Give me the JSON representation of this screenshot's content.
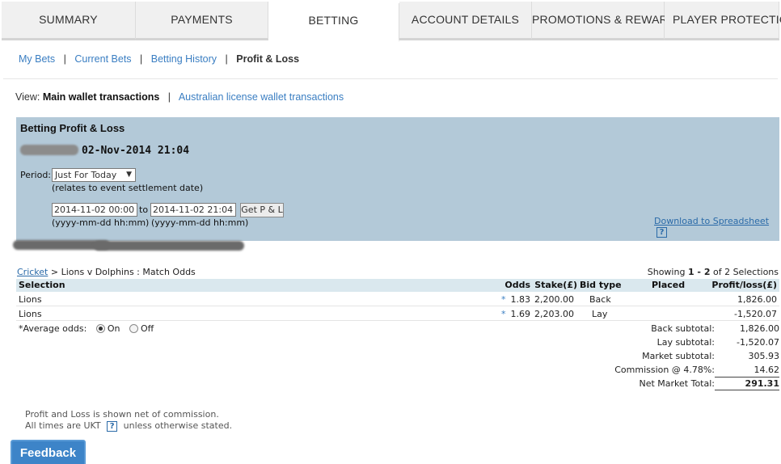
{
  "tabs": [
    {
      "label": "SUMMARY"
    },
    {
      "label": "PAYMENTS"
    },
    {
      "label": "BETTING"
    },
    {
      "label": "ACCOUNT DETAILS"
    },
    {
      "label": "PROMOTIONS & REWARDS"
    },
    {
      "label": "PLAYER PROTECTION"
    }
  ],
  "subnav": {
    "my_bets": "My Bets",
    "current_bets": "Current Bets",
    "betting_history": "Betting History",
    "profit_loss": "Profit & Loss",
    "separator": "|"
  },
  "view": {
    "prefix": "View:",
    "main": "Main wallet transactions",
    "separator": "|",
    "australian": "Australian license wallet transactions"
  },
  "panel": {
    "title": "Betting Profit & Loss",
    "datetime": "02-Nov-2014 21:04",
    "period_label": "Period:",
    "period_value": "Just For Today",
    "period_arrow": "▼",
    "relates_note": "(relates to event settlement date)",
    "from_value": "2014-11-02 00:00",
    "to_label": "to",
    "to_value": "2014-11-02 21:04",
    "format_hint": "(yyyy-mm-dd hh:mm)",
    "get_button": "Get P & L",
    "download_link": "Download to Spreadsheet",
    "help": "?"
  },
  "results": {
    "crumb_sport": "Cricket",
    "crumb_rest": " > Lions v Dolphins : Match Odds",
    "showing_prefix": "Showing ",
    "showing_range": "1 - 2",
    "showing_suffix": " of 2 Selections",
    "headers": {
      "selection": "Selection",
      "odds": "Odds",
      "stake": "Stake(£)",
      "bid_type": "Bid type",
      "placed": "Placed",
      "profit": "Profit/loss(£)"
    },
    "rows": [
      {
        "selection": "Lions",
        "star": "*",
        "odds": "1.83",
        "stake": "2,200.00",
        "bid_type": "Back",
        "placed": "",
        "profit": "1,826.00"
      },
      {
        "selection": "Lions",
        "star": "*",
        "odds": "1.69",
        "stake": "2,203.00",
        "bid_type": "Lay",
        "placed": "",
        "profit": "-1,520.07"
      }
    ],
    "avg_odds_label": "*Average odds:",
    "avg_on": "On",
    "avg_off": "Off",
    "totals": {
      "back_label": "Back subtotal:",
      "back_value": "1,826.00",
      "lay_label": "Lay subtotal:",
      "lay_value": "-1,520.07",
      "market_label": "Market subtotal:",
      "market_value": "305.93",
      "commission_label": "Commission @ 4.78%:",
      "commission_value": "14.62",
      "net_label": "Net Market Total:",
      "net_value": "291.31"
    }
  },
  "footer": {
    "line1": "Profit and Loss is shown net of commission.",
    "line2_a": "All times are UKT",
    "line2_b": "unless otherwise stated.",
    "help": "?"
  },
  "feedback_label": "Feedback"
}
